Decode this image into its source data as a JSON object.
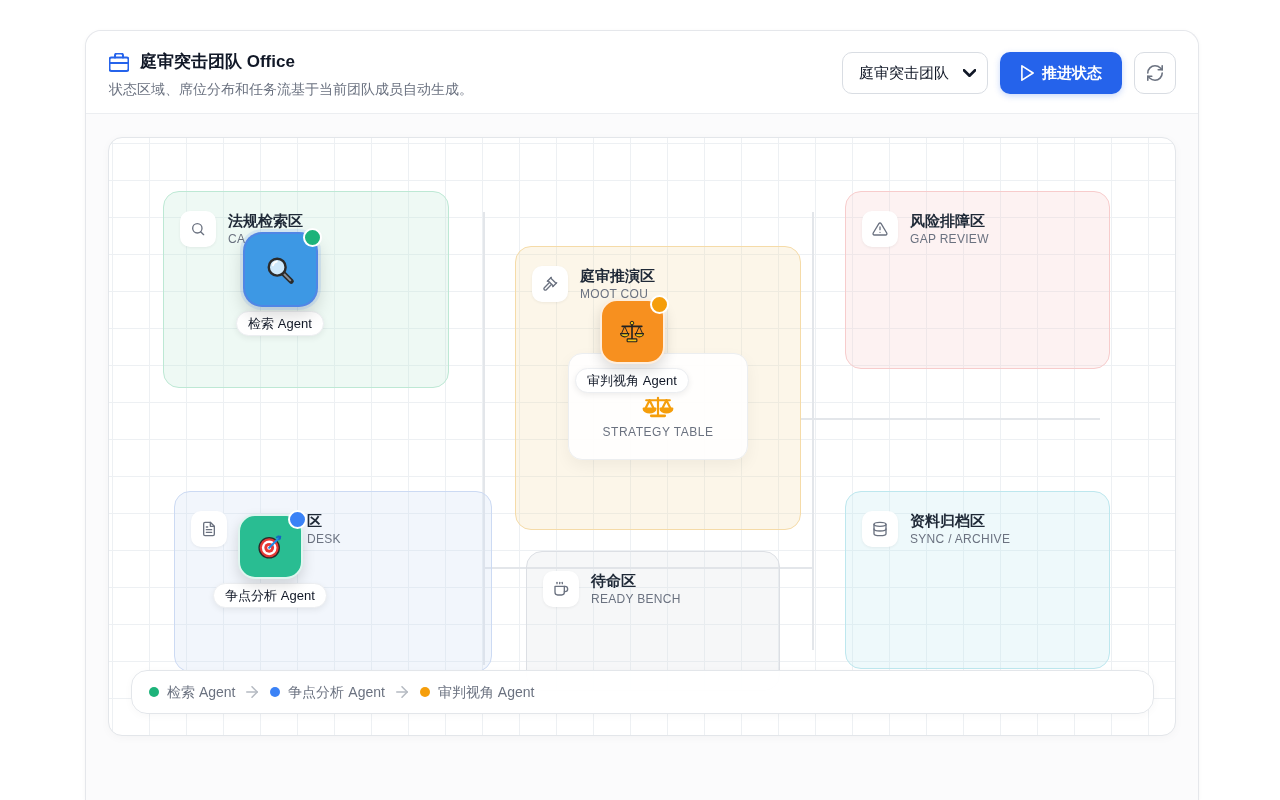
{
  "header": {
    "title": "庭审突击团队 Office",
    "subtitle": "状态区域、席位分布和任务流基于当前团队成员自动生成。",
    "team_select": {
      "value": "庭审突击团队"
    },
    "advance_button": {
      "label": "推进状态"
    }
  },
  "zones": [
    {
      "title": "法规检索区",
      "subtitle": "CA",
      "color": "#bde8d4"
    },
    {
      "title": "庭审推演区",
      "subtitle": "MOOT COU",
      "color": "#f5dba8",
      "station": {
        "label": "STRATEGY TABLE"
      }
    },
    {
      "title": "风险排障区",
      "subtitle": "GAP REVIEW",
      "color": "#f7cccc"
    },
    {
      "title": "区",
      "subtitle": "DESK",
      "color": "#ccdaf3"
    },
    {
      "title": "待命区",
      "subtitle": "READY BENCH",
      "color": "#dcdfe4"
    },
    {
      "title": "资料归档区",
      "subtitle": "SYNC / ARCHIVE",
      "color": "#bde7ee"
    }
  ],
  "agents": [
    {
      "name": "检索 Agent",
      "color": "#1db37a",
      "avatar": {
        "color": "#3d98e4"
      },
      "active": true
    },
    {
      "name": "审判视角 Agent",
      "color": "#f59e0b",
      "avatar": {
        "color": "#f7901f"
      },
      "active": false
    },
    {
      "name": "争点分析 Agent",
      "color": "#3b82f6",
      "avatar": {
        "color": "#29bd92"
      },
      "active": false
    }
  ],
  "flow": [
    {
      "label": "检索 Agent",
      "color": "#1db37a"
    },
    {
      "label": "争点分析 Agent",
      "color": "#3b82f6"
    },
    {
      "label": "审判视角 Agent",
      "color": "#f59e0b"
    }
  ]
}
